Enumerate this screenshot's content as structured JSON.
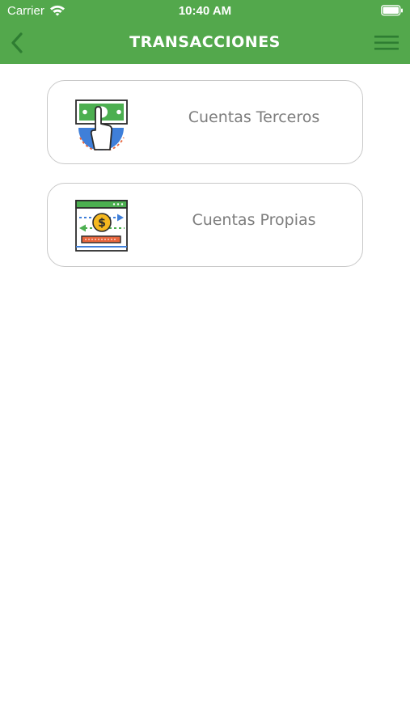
{
  "status_bar": {
    "carrier": "Carrier",
    "time": "10:40 AM",
    "wifi_icon": "wifi-icon",
    "battery_icon": "battery-icon"
  },
  "header": {
    "title": "TRANSACCIONES",
    "back_icon": "chevron-left-icon",
    "menu_icon": "hamburger-menu-icon",
    "background_color": "#53a84c"
  },
  "options": [
    {
      "label": "Cuentas Terceros",
      "icon": "hand-money-transfer-icon"
    },
    {
      "label": "Cuentas Propias",
      "icon": "account-transfer-icon"
    }
  ],
  "colors": {
    "accent": "#53a84c",
    "label_text": "#7d7d7d",
    "card_border": "#c8c8c8"
  }
}
